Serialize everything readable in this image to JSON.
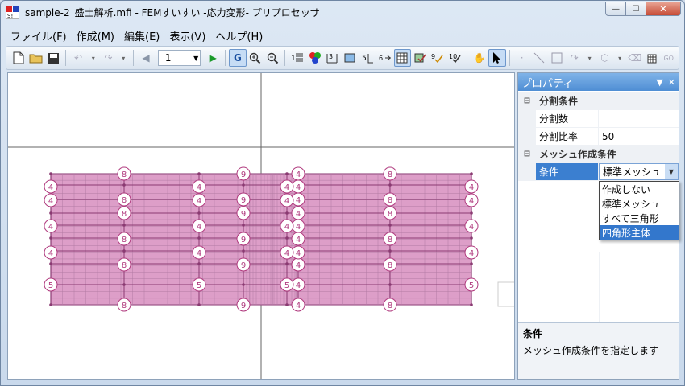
{
  "window": {
    "title": "sample-2_盛土解析.mfi - FEMすいすい -応力変形- プリプロセッサ",
    "icon_name": "app-logo-icon"
  },
  "caption_buttons": {
    "minimize": "—",
    "maximize": "☐",
    "close": "✕"
  },
  "menu": [
    "ファイル(F)",
    "作成(M)",
    "編集(E)",
    "表示(V)",
    "ヘルプ(H)"
  ],
  "toolbar": {
    "page_value": "1",
    "icons": [
      "new-file-icon",
      "open-folder-icon",
      "save-icon",
      "undo-icon",
      "redo-icon",
      "prev-icon",
      "play-icon",
      "grid-snap-icon",
      "zoom-in-icon",
      "zoom-out-icon",
      "hand-pan-icon",
      "pointer-icon"
    ]
  },
  "properties": {
    "header": "プロパティ",
    "categories": [
      {
        "label": "分割条件",
        "rows": [
          {
            "name": "分割数",
            "value": ""
          },
          {
            "name": "分割比率",
            "value": "50"
          }
        ]
      },
      {
        "label": "メッシュ作成条件",
        "rows": [
          {
            "name": "条件",
            "value": "標準メッシュ"
          }
        ]
      }
    ],
    "dropdown_options": [
      "作成しない",
      "標準メッシュ",
      "すべて三角形",
      "四角形主体"
    ],
    "highlighted_option": "四角形主体",
    "description": {
      "title": "条件",
      "text": "メッシュ作成条件を指定します"
    }
  },
  "mesh": {
    "fill_color": "#dd9ec8",
    "stroke_color": "#8a3a72",
    "circle_color": "#b03a7e",
    "labels": {
      "col_8a": [
        "8",
        "8",
        "8",
        "8",
        "8",
        "8"
      ],
      "col_9": [
        "9",
        "9",
        "9",
        "9",
        "9",
        "9"
      ],
      "col_4": [
        "4",
        "4",
        "4",
        "4",
        "4",
        "4",
        "4"
      ],
      "edge_left": [
        "4",
        "4",
        "4",
        "4",
        "5"
      ],
      "col_5": "5"
    }
  }
}
